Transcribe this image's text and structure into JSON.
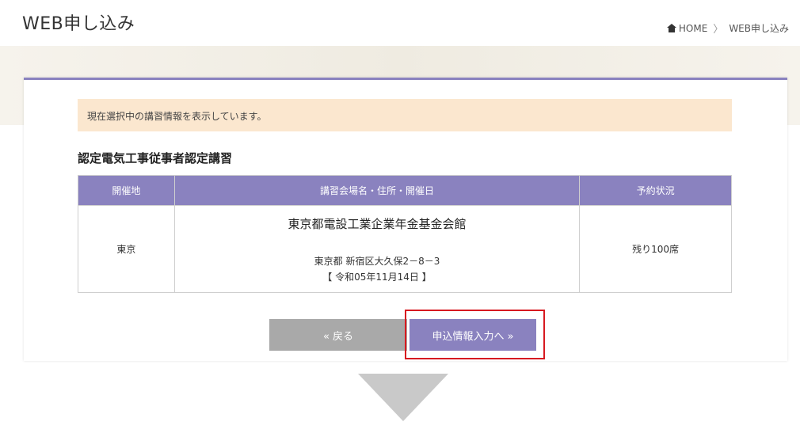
{
  "header": {
    "title": "WEB申し込み",
    "breadcrumb": {
      "home": "HOME",
      "current": "WEB申し込み",
      "separator": "〉"
    }
  },
  "notice": "現在選択中の講習情報を表示しています。",
  "course_title": "認定電気工事従事者認定講習",
  "table": {
    "headers": {
      "place": "開催地",
      "venue": "講習会場名・住所・開催日",
      "status": "予約状況"
    },
    "row": {
      "place": "東京",
      "venue_name": "東京都電設工業企業年金基金会館",
      "address": "東京都 新宿区大久保2－8－3",
      "date": "【 令和05年11月14日 】",
      "status": "残り100席"
    }
  },
  "buttons": {
    "back_label": "« 戻る",
    "next_label": "申込情報入力へ »"
  },
  "colors": {
    "accent": "#8a82bf",
    "notice_bg": "#fbe7cf",
    "back_button": "#a9a9a9",
    "highlight": "#d71920",
    "arrow": "#c9c9c9"
  },
  "icons": {
    "home": "home-icon",
    "separator": "chevron-right-icon",
    "arrow": "down-triangle-icon"
  }
}
